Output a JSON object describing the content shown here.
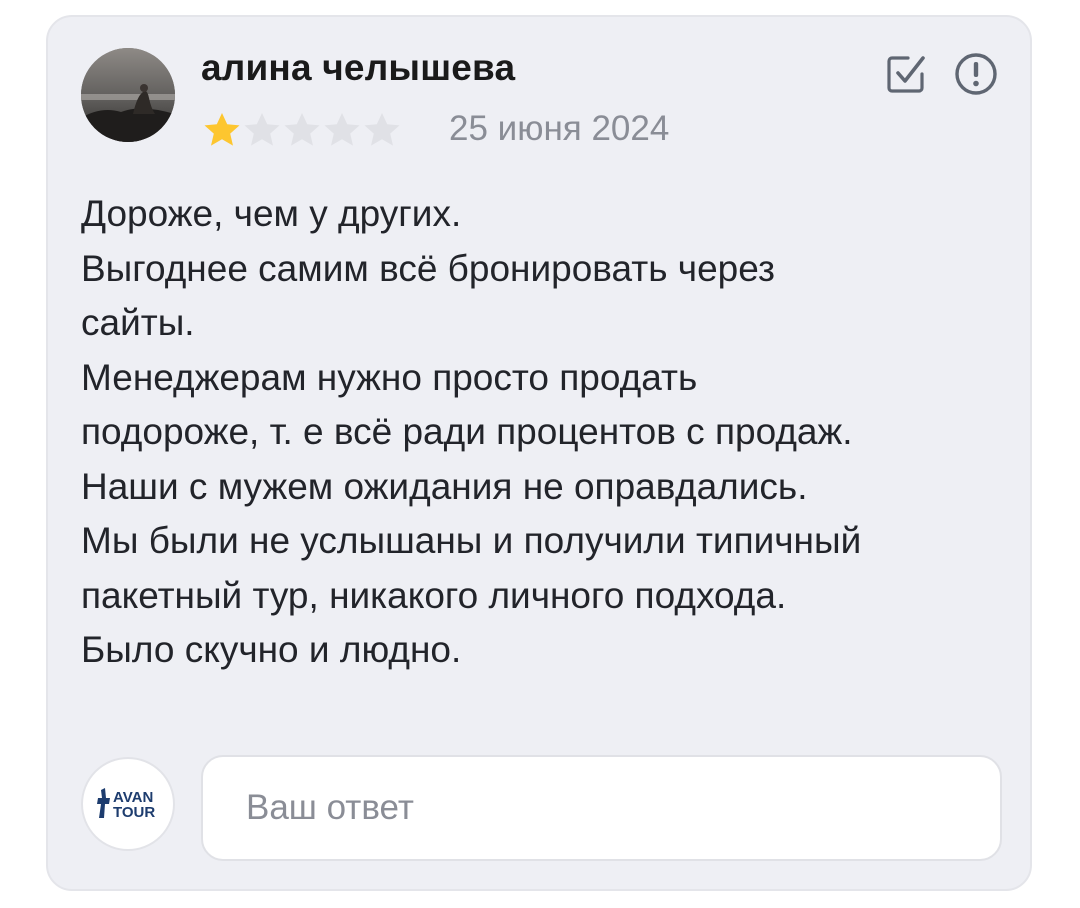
{
  "review": {
    "author_name": "алина челышева",
    "rating": 1,
    "rating_max": 5,
    "date": "25 июня 2024",
    "text_lines": [
      "Дороже, чем у других.",
      "Выгоднее самим всё бронировать через",
      "сайты.",
      "Менеджерам нужно просто продать",
      "подороже, т. е всё ради процентов с продаж.",
      "Наши с мужем ожидания не оправдались.",
      "Мы были не услышаны и получили типичный",
      "пакетный тур, никакого личного подхода.",
      "Было скучно и людно."
    ],
    "actions": {
      "edit_icon": "checkbox-edit-icon",
      "report_icon": "exclamation-circle-icon"
    }
  },
  "reply": {
    "logo_text": "AVAN TOUR",
    "placeholder": "Ваш ответ"
  },
  "colors": {
    "card_background": "#eeeff4",
    "star_filled": "#fdc62f",
    "star_empty": "#e0e1e6",
    "secondary_text": "#8a8d96",
    "logo_blue": "#1d3c6e"
  }
}
